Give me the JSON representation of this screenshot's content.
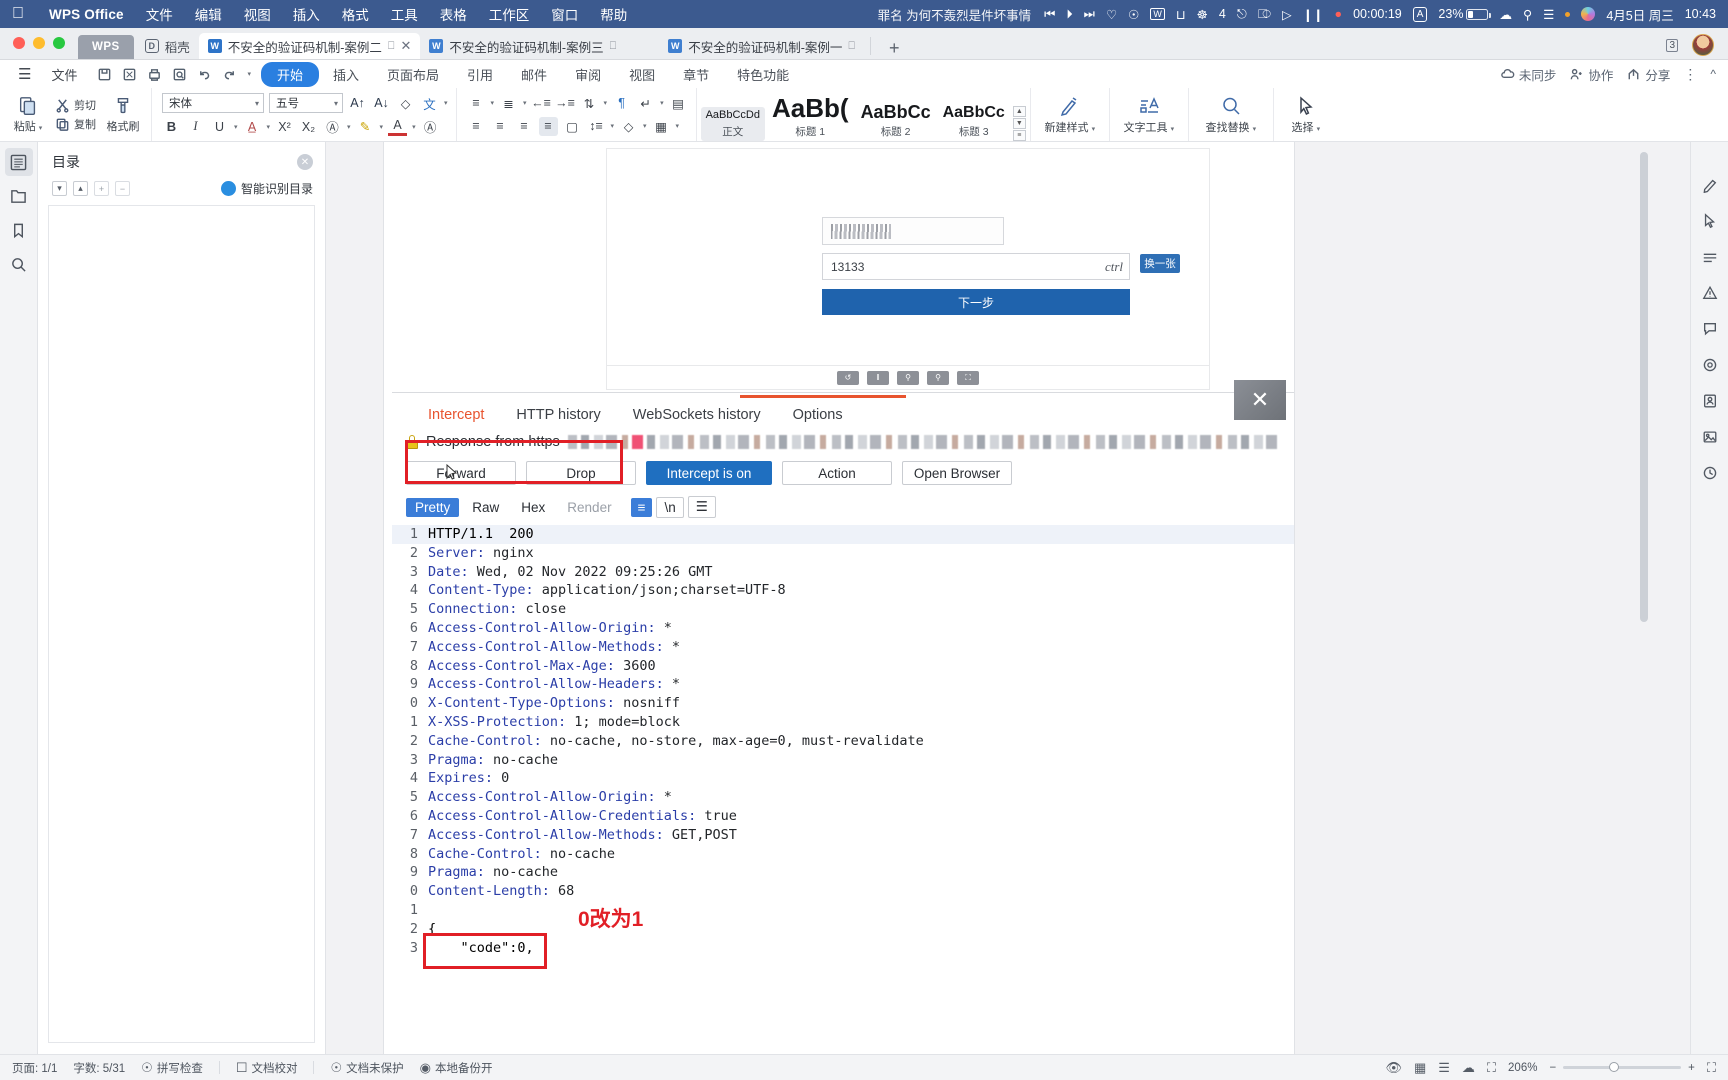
{
  "macbar": {
    "apple_icon": "apple-icon",
    "brand": "WPS Office",
    "menus": [
      "文件",
      "编辑",
      "视图",
      "插入",
      "格式",
      "工具",
      "表格",
      "工作区",
      "窗口",
      "帮助"
    ],
    "now_playing": "罪名 为何不轰烈是件坏事情",
    "media_icons": [
      "prev-track-icon",
      "play-icon",
      "next-track-icon",
      "heart-icon",
      "netease-music-icon"
    ],
    "tray_icons": [
      "wps-tray-icon",
      "bookmark-tray-icon",
      "wechat-icon",
      "screen-share-icon",
      "airplay-icon"
    ],
    "wechat_badge": "4",
    "recording": {
      "icons": [
        "record-play-icon",
        "record-pause-icon",
        "record-stop-icon"
      ],
      "time": "00:00:19"
    },
    "input_source": "A",
    "battery_percent": "23%",
    "battery_level": 23,
    "status_icons": [
      "wifi-icon",
      "spotlight-search-icon",
      "control-center-icon",
      "siri-icon"
    ],
    "date": "4月5日 周三",
    "time": "10:43"
  },
  "tabstrip": {
    "wps_button": "WPS",
    "daoke_tab": "稻壳",
    "tabs": [
      {
        "title": "不安全的验证码机制-案例二",
        "active": true,
        "closeable": true
      },
      {
        "title": "不安全的验证码机制-案例三",
        "active": false,
        "closeable": false
      },
      {
        "title": "不安全的验证码机制-案例一",
        "active": false,
        "closeable": false
      }
    ],
    "new_tab": "+",
    "window_count": "3",
    "avatar": "user-avatar"
  },
  "ribbon_menu": {
    "hamburger": "hamburger-icon",
    "file_label": "文件",
    "quick_icons": [
      "save-icon",
      "save-as-icon",
      "print-icon",
      "print-preview-icon",
      "undo-icon",
      "redo-icon",
      "customize-qat-icon"
    ],
    "tabs": [
      {
        "label": "开始",
        "selected": true
      },
      {
        "label": "插入",
        "selected": false
      },
      {
        "label": "页面布局",
        "selected": false
      },
      {
        "label": "引用",
        "selected": false
      },
      {
        "label": "邮件",
        "selected": false
      },
      {
        "label": "审阅",
        "selected": false
      },
      {
        "label": "视图",
        "selected": false
      },
      {
        "label": "章节",
        "selected": false
      },
      {
        "label": "特色功能",
        "selected": false
      }
    ],
    "right": {
      "sync": "未同步",
      "collab": "协作",
      "share": "分享",
      "more": "more-icon",
      "collapse": "collapse-ribbon-icon"
    }
  },
  "toolbar": {
    "paste": "粘贴",
    "cut": "剪切",
    "copy": "复制",
    "format_brush": "格式刷",
    "font_name": "宋体",
    "font_size": "五号",
    "grow_font": "grow-font-icon",
    "shrink_font": "shrink-font-icon",
    "clear_format": "clear-format-icon",
    "pinyin": "pinyin-guide-icon",
    "bold": "B",
    "italic": "I",
    "underline": "U",
    "strikethrough": "strikethrough-icon",
    "superscript": "X²",
    "subscript": "X₂",
    "char_border": "character-border-icon",
    "highlight": "highlight-color-icon",
    "font_color": "font-color-icon",
    "char_shading": "character-shading-icon",
    "bullets": "bullet-list-icon",
    "numbering": "numbered-list-icon",
    "decrease_indent": "decrease-indent-icon",
    "increase_indent": "increase-indent-icon",
    "sort": "sort-icon",
    "show_marks": "show-formatting-marks-icon",
    "align_left": "align-left-icon",
    "align_center": "align-center-icon",
    "align_right": "align-right-icon",
    "justify": "justify-icon",
    "distribute": "distribute-icon",
    "line_spacing": "line-spacing-icon",
    "shading": "paragraph-shading-icon",
    "borders": "borders-icon",
    "styles": [
      {
        "preview": "AaBbCcDd",
        "name": "正文",
        "size": "11px",
        "selected": true
      },
      {
        "preview": "AaBb(",
        "name": "标题 1",
        "size": "26px",
        "selected": false
      },
      {
        "preview": "AaBbCc",
        "name": "标题 2",
        "size": "18px",
        "selected": false
      },
      {
        "preview": "AaBbCc",
        "name": "标题 3",
        "size": "15px",
        "selected": false
      }
    ],
    "new_style": "新建样式",
    "text_tools": "文字工具",
    "find_replace": "查找替换",
    "select": "选择"
  },
  "left_rail": [
    "outline-panel-icon",
    "thumbnails-icon",
    "bookmark-icon",
    "search-panel-icon"
  ],
  "outline": {
    "title": "目录",
    "close": "close-icon",
    "tools": [
      "expand-all-icon",
      "collapse-all-icon",
      "promote-icon",
      "demote-icon"
    ],
    "ai_label": "智能识别目录"
  },
  "document": {
    "screenshot": {
      "captcha_value": "13133",
      "refresh_label": "换一张",
      "hand_text": "ctrl",
      "next_button": "下一步"
    },
    "burp": {
      "tabs": [
        "Intercept",
        "HTTP history",
        "WebSockets history",
        "Options"
      ],
      "active_tab": "Intercept",
      "response_label": "Response from https",
      "buttons": [
        "Forward",
        "Drop",
        "Intercept is on",
        "Action",
        "Open Browser"
      ],
      "primary_button": "Intercept is on",
      "view_tabs": [
        "Pretty",
        "Raw",
        "Hex",
        "Render"
      ],
      "active_view_tab": "Pretty",
      "disabled_view_tab": "Render",
      "annotation": "0改为1",
      "http_lines": [
        {
          "n": "1",
          "key": "",
          "val": "HTTP/1.1  200"
        },
        {
          "n": "2",
          "key": "Server",
          "val": " nginx"
        },
        {
          "n": "3",
          "key": "Date",
          "val": " Wed, 02 Nov 2022 09:25:26 GMT"
        },
        {
          "n": "4",
          "key": "Content-Type",
          "val": " application/json;charset=UTF-8"
        },
        {
          "n": "5",
          "key": "Connection",
          "val": " close"
        },
        {
          "n": "6",
          "key": "Access-Control-Allow-Origin",
          "val": " *"
        },
        {
          "n": "7",
          "key": "Access-Control-Allow-Methods",
          "val": " *"
        },
        {
          "n": "8",
          "key": "Access-Control-Max-Age",
          "val": " 3600"
        },
        {
          "n": "9",
          "key": "Access-Control-Allow-Headers",
          "val": " *"
        },
        {
          "n": "0",
          "key": "X-Content-Type-Options",
          "val": " nosniff"
        },
        {
          "n": "1",
          "key": "X-XSS-Protection",
          "val": " 1; mode=block"
        },
        {
          "n": "2",
          "key": "Cache-Control",
          "val": " no-cache, no-store, max-age=0, must-revalidate"
        },
        {
          "n": "3",
          "key": "Pragma",
          "val": " no-cache"
        },
        {
          "n": "4",
          "key": "Expires",
          "val": " 0"
        },
        {
          "n": "5",
          "key": "Access-Control-Allow-Origin",
          "val": " *"
        },
        {
          "n": "6",
          "key": "Access-Control-Allow-Credentials",
          "val": " true"
        },
        {
          "n": "7",
          "key": "Access-Control-Allow-Methods",
          "val": " GET,POST"
        },
        {
          "n": "8",
          "key": "Cache-Control",
          "val": " no-cache"
        },
        {
          "n": "9",
          "key": "Pragma",
          "val": " no-cache"
        },
        {
          "n": "0",
          "key": "Content-Length",
          "val": " 68"
        },
        {
          "n": "1",
          "key": "",
          "val": ""
        },
        {
          "n": "2",
          "key": "",
          "val": "{"
        },
        {
          "n": "3",
          "key": "",
          "val": "    \"code\":0,"
        }
      ]
    }
  },
  "right_rail": [
    "edit-panel-icon",
    "select-object-icon",
    "insert-shape-icon",
    "warning-icon",
    "comment-icon",
    "layers-icon",
    "contacts-icon",
    "image-panel-icon",
    "history-icon"
  ],
  "statusbar": {
    "page": "页面: 1/1",
    "words": "字数: 5/31",
    "spellcheck": "拼写检查",
    "proofread": "文档校对",
    "protection": "文档未保护",
    "backup": "本地备份开",
    "view_icons": [
      "eye-icon",
      "print-layout-icon",
      "reading-layout-icon",
      "web-layout-icon",
      "fullscreen-icon"
    ],
    "zoom": "206%",
    "zoom_out": "−",
    "zoom_in": "+",
    "fit_page": "fit-page-icon"
  },
  "colors": {
    "macbar_bg": "#3c5a8f",
    "accent_blue": "#2a7fe0",
    "burp_orange": "#e8542f",
    "burp_button_blue": "#1f6fc0",
    "annotation_red": "#e11f26"
  }
}
